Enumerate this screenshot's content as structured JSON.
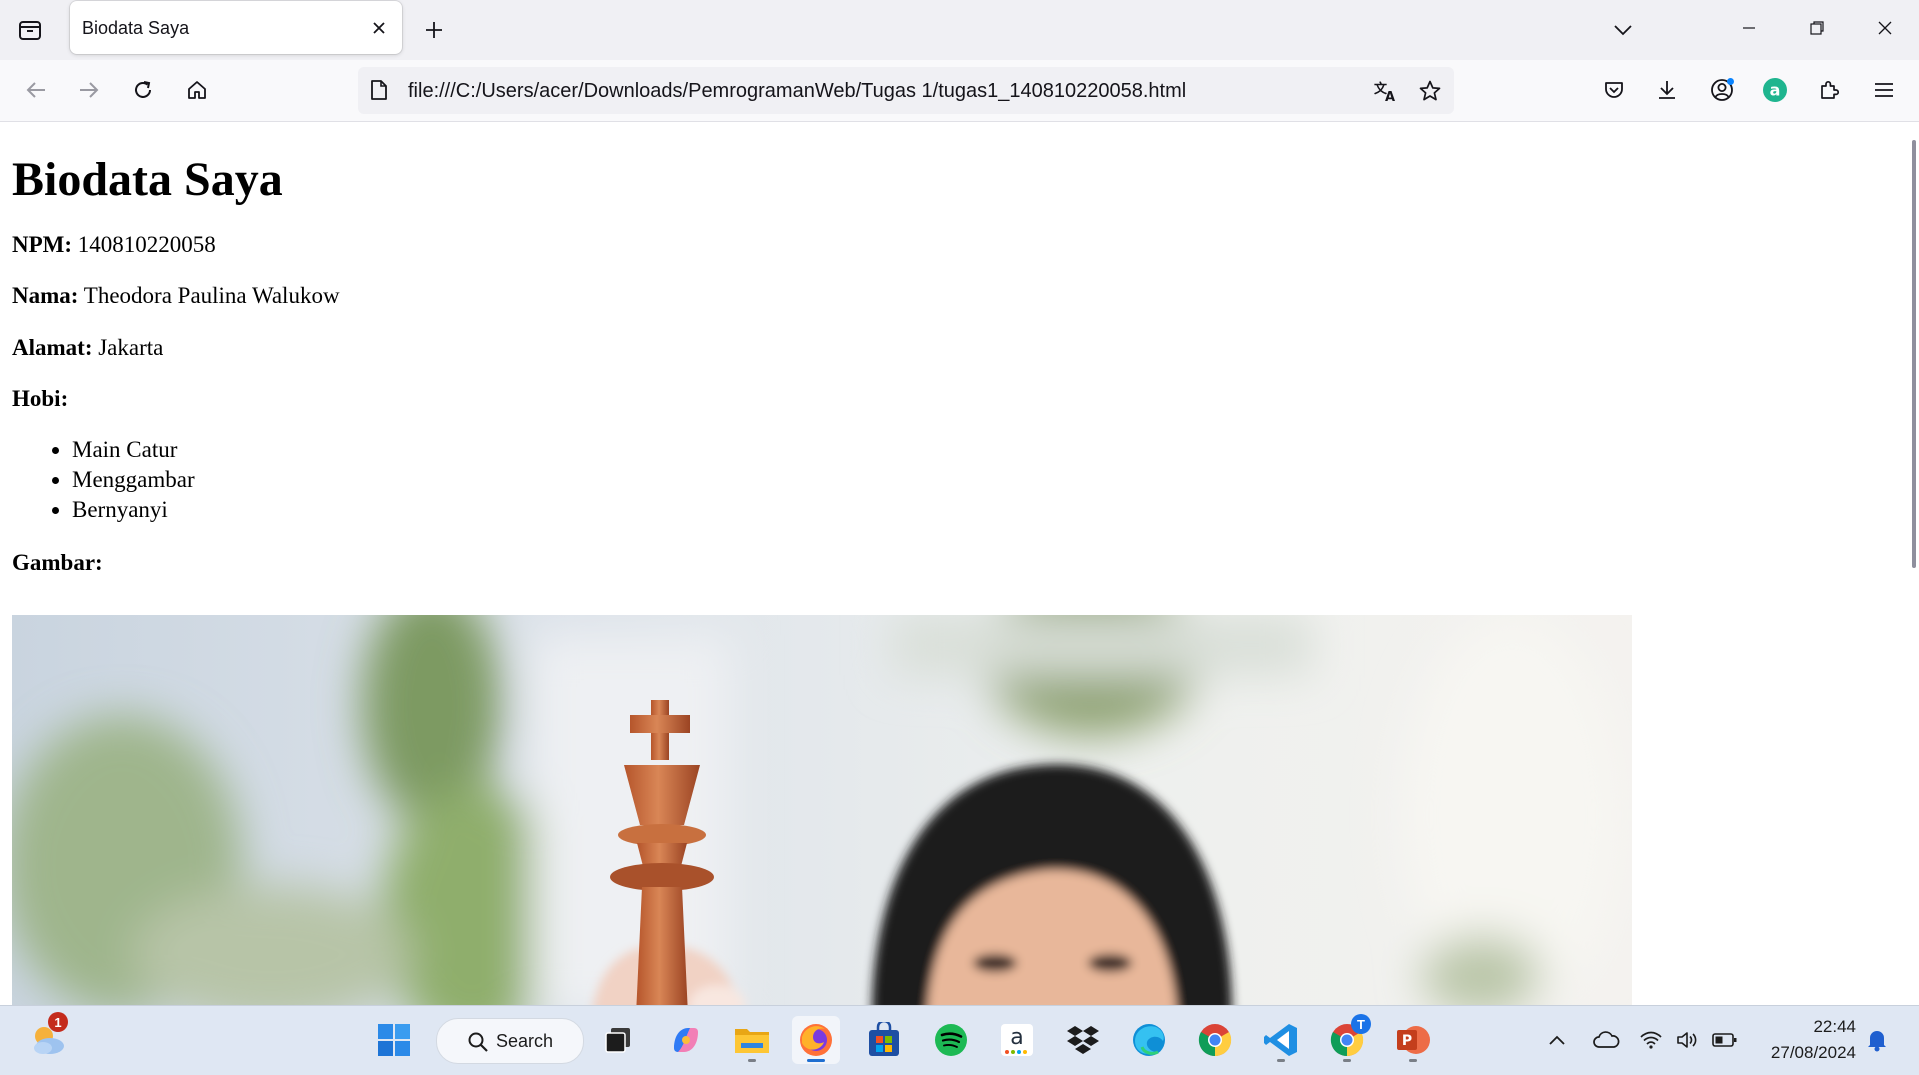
{
  "browser": {
    "tab_title": "Biodata Saya",
    "url": "file:///C:/Users/acer/Downloads/PemrogramanWeb/Tugas 1/tugas1_140810220058.html"
  },
  "page": {
    "heading": "Biodata Saya",
    "npm_label": "NPM:",
    "npm_value": "140810220058",
    "nama_label": "Nama:",
    "nama_value": "Theodora Paulina Walukow",
    "alamat_label": "Alamat:",
    "alamat_value": "Jakarta",
    "hobi_label": "Hobi:",
    "hobbies": [
      "Main Catur",
      "Menggambar",
      "Bernyanyi"
    ],
    "gambar_label": "Gambar:"
  },
  "taskbar": {
    "search_label": "Search",
    "weather_badge": "1",
    "time": "22:44",
    "date": "27/08/2024",
    "chrome_profile_badge": "T"
  },
  "icons": {
    "tab_list": "tab-list-icon",
    "close": "close-icon",
    "new_tab": "plus-icon",
    "back": "back-arrow-icon",
    "forward": "forward-arrow-icon",
    "reload": "reload-icon",
    "home": "home-icon",
    "translate": "translate-icon",
    "bookmark": "star-icon",
    "pocket": "pocket-icon",
    "downloads": "download-icon",
    "account": "account-icon",
    "extensions": "puzzle-icon",
    "menu": "hamburger-menu-icon"
  },
  "colors": {
    "chrome_bg": "#f0f0f4",
    "taskbar_bg": "#dfe7f3",
    "accent": "#0061e0"
  }
}
